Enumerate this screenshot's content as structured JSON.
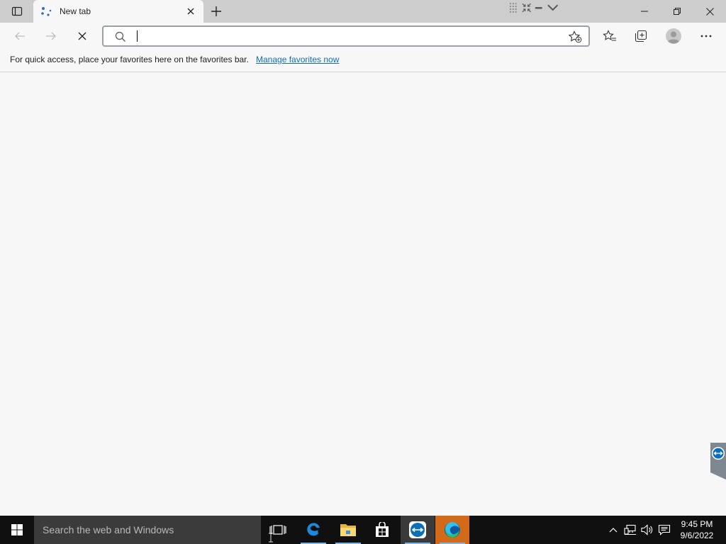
{
  "browser": {
    "tab": {
      "title": "New tab"
    },
    "address_bar": {
      "value": "",
      "placeholder": ""
    },
    "favorites_bar": {
      "message": "For quick access, place your favorites here on the favorites bar.",
      "link": "Manage favorites now"
    }
  },
  "taskbar": {
    "search_placeholder": "Search the web and Windows",
    "clock": {
      "time": "9:45 PM",
      "date": "9/6/2022"
    }
  },
  "colors": {
    "accent_link": "#0f6cbd",
    "taskbar_bg": "#101010",
    "teamviewer": "#0e6eb8",
    "edge_orange": "#e07a1f"
  }
}
